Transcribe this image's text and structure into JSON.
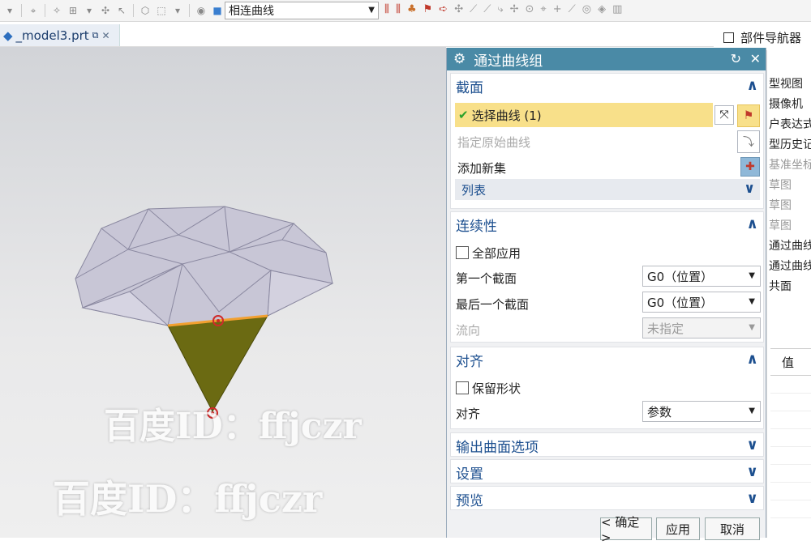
{
  "toolbar": {
    "filter_value": "相连曲线"
  },
  "tab": {
    "file_name": "_model3.prt"
  },
  "navigator": {
    "header_label": "部件导航器",
    "items": [
      "型视图",
      "摄像机",
      "户表达式",
      "型历史记录",
      "基准坐标系",
      "草图",
      "草图",
      "草图",
      "通过曲线组",
      "通过曲线组",
      "共面"
    ],
    "column_header": "值"
  },
  "watermark": {
    "text1": "百度ID：ffjczr",
    "text2": "百度ID：ffjczr"
  },
  "dialog": {
    "title": "通过曲线组",
    "section": {
      "header": "截面",
      "select_curve": "选择曲线 (1)",
      "specify_origin": "指定原始曲线",
      "add_new_set": "添加新集",
      "list_label": "列表"
    },
    "continuity": {
      "header": "连续性",
      "apply_all": "全部应用",
      "first_section_label": "第一个截面",
      "first_section_value": "G0（位置）",
      "last_section_label": "最后一个截面",
      "last_section_value": "G0（位置）",
      "flow_label": "流向",
      "flow_value": "未指定"
    },
    "alignment": {
      "header": "对齐",
      "keep_shape": "保留形状",
      "align_label": "对齐",
      "align_value": "参数"
    },
    "output": {
      "header": "输出曲面选项"
    },
    "settings": {
      "header": "设置"
    },
    "preview": {
      "header": "预览"
    },
    "buttons": {
      "ok": "< 确定 >",
      "apply": "应用",
      "cancel": "取消"
    }
  },
  "colors": {
    "title_bar": "#4a8aa6",
    "selected_row": "#f8e08a",
    "group_header": "#1c4f8f",
    "surface_fill": "#6b6a12"
  }
}
